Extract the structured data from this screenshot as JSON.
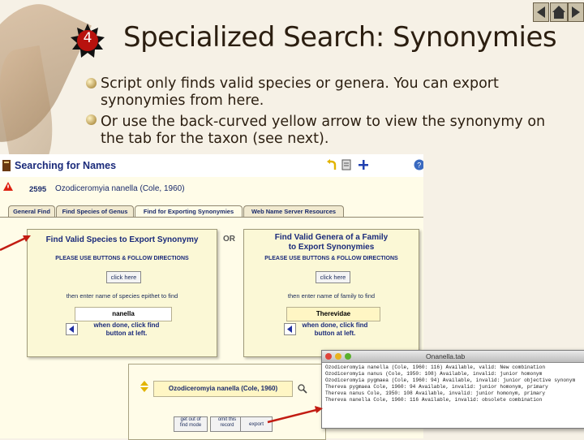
{
  "slide": {
    "number": "4",
    "title": "Specialized Search: Synonymies",
    "bullets": [
      {
        "line1": "Script only finds valid species or genera.  You can export",
        "line2": "synonymies from here."
      },
      {
        "line1": "Or use the back-curved yellow arrow to view the synonymy on",
        "line2": "the tab for the taxon (see next)."
      }
    ]
  },
  "app": {
    "header_title": "Searching for Names",
    "record": {
      "number": "2595",
      "name": "Ozodiceromyia nanella (Cole, 1960)"
    },
    "tabs": [
      "General Find",
      "Find Species of Genus",
      "Find for Exporting Synonymies",
      "Web Name Server Resources"
    ],
    "or_label": "OR",
    "left_panel": {
      "title": "Find Valid Species to Export Synonymy",
      "directions": "PLEASE USE BUTTONS & FOLLOW DIRECTIONS",
      "button": "click here",
      "prompt": "then enter name of species epithet to find",
      "value": "nanella",
      "done1": "when done, click find",
      "done2": "button at left."
    },
    "right_panel": {
      "title1": "Find Valid Genera of a Family",
      "title2": "to Export Synonymies",
      "directions": "PLEASE USE BUTTONS & FOLLOW DIRECTIONS",
      "button": "click here",
      "prompt": "then enter name of family to find",
      "value": "Therevidae",
      "done1": "when done, click find",
      "done2": "button at left."
    },
    "lower": {
      "result_name": "Ozodiceromyia nanella (Cole, 1960)",
      "btn_get_out_1": "get out of",
      "btn_get_out_2": "find mode",
      "btn_omit_1": "omit this",
      "btn_omit_2": "record",
      "btn_export": "export"
    }
  },
  "tab_window": {
    "title": "Onanella.tab",
    "lines": [
      "Ozodiceromyia nanella (Cole, 1960: 116)  Available, valid: New combination",
      "Ozodiceromyia nanus (Cole, 1950: 108)    Available, invalid: junior homonym",
      "Ozodiceromyia pygmaea (Cole, 1960: 94)   Available, invalid: junior objective synonym",
      "Thereva pygmaea Cole, 1960: 94           Available, invalid: junior homonym, primary",
      "Thereva nanus Cole, 1950: 108            Available, invalid: junior homonym, primary",
      "Thereva nanella Cole, 1960: 116          Available, invalid: obsolete combination"
    ]
  },
  "colors": {
    "accent": "#1a2a7a",
    "background": "#f6f1e6",
    "badge": "#b8120e",
    "panel": "#fbf8d6",
    "arrow_red": "#c21c12"
  }
}
